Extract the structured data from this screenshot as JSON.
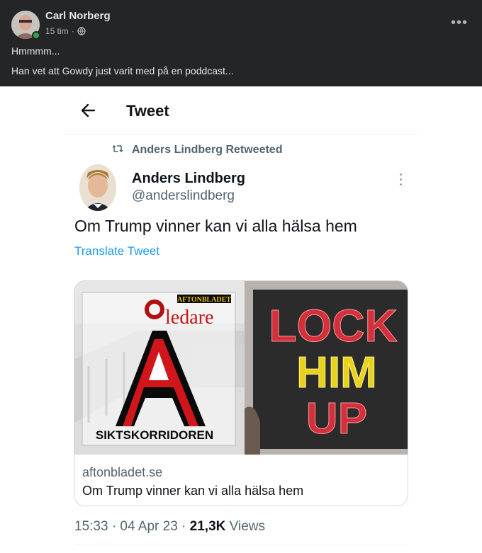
{
  "facebook_post": {
    "author": "Carl Norberg",
    "time": "15 tim",
    "separator": "·",
    "privacy_icon": "globe-icon",
    "more_icon": "more-horizontal-icon",
    "more_label": "•••",
    "text_lines": [
      "Hmmmm...",
      "Han vet att Gowdy just varit med på en poddcast..."
    ]
  },
  "tweet": {
    "header_title": "Tweet",
    "back_icon": "arrow-left-icon",
    "retweet_label": "Anders Lindberg Retweeted",
    "author_name": "Anders Lindberg",
    "author_handle": "@anderslindberg",
    "body": "Om Trump vinner kan vi alla hälsa hem",
    "translate_label": "Translate Tweet",
    "card": {
      "domain": "aftonbladet.se",
      "title": "Om Trump vinner kan vi alla hälsa hem",
      "image_text": {
        "brand_small": "AFTONBLADET",
        "ledare": "ledare",
        "siktskorridoren": "SIKTSKORRIDOREN",
        "sign_lines": [
          "LOCK",
          "HIM",
          "UP"
        ]
      }
    },
    "timestamp": "15:33 · 04 Apr 23 ·",
    "views_count": "21,3K",
    "views_label": "Views"
  },
  "colors": {
    "facebook_bg": "#242526",
    "twitter_link": "#1d9bf0",
    "twitter_muted": "#536471",
    "online_green": "#31a24c"
  }
}
